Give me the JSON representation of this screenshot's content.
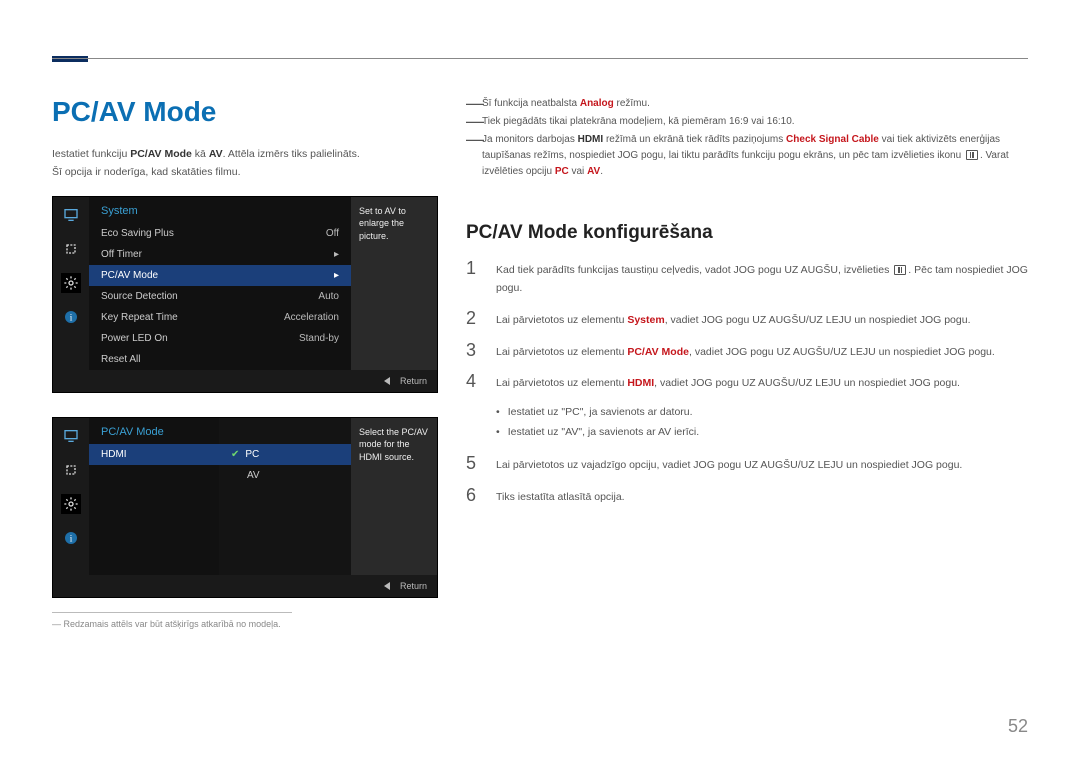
{
  "page_number": "52",
  "left": {
    "h1": "PC/AV Mode",
    "intro_pre": "Iestatiet funkciju ",
    "intro_kw1": "PC/AV Mode",
    "intro_mid": " kā ",
    "intro_kw2": "AV",
    "intro_post": ". Attēla izmērs tiks palielināts.",
    "intro2": "Šī opcija ir noderīga, kad skatāties filmu.",
    "footnote": "Redzamais attēls var būt atšķirīgs atkarībā no modeļa."
  },
  "osd1": {
    "title": "System",
    "side": "Set to AV to enlarge the picture.",
    "return": "Return",
    "rows": [
      {
        "l": "Eco Saving Plus",
        "r": "Off",
        "sel": false
      },
      {
        "l": "Off Timer",
        "r": "▸",
        "sel": false
      },
      {
        "l": "PC/AV Mode",
        "r": "▸",
        "sel": true
      },
      {
        "l": "Source Detection",
        "r": "Auto",
        "sel": false
      },
      {
        "l": "Key Repeat Time",
        "r": "Acceleration",
        "sel": false
      },
      {
        "l": "Power LED On",
        "r": "Stand-by",
        "sel": false
      },
      {
        "l": "Reset All",
        "r": "",
        "sel": false
      }
    ]
  },
  "osd2": {
    "title": "PC/AV Mode",
    "side": "Select the PC/AV mode for the HDMI source.",
    "left_item": "HDMI",
    "opts": [
      {
        "l": "PC",
        "sel": true
      },
      {
        "l": "AV",
        "sel": false
      }
    ],
    "return": "Return"
  },
  "right": {
    "dash1_pre": "Šī funkcija neatbalsta ",
    "dash1_kw": "Analog",
    "dash1_post": " režīmu.",
    "dash2": "Tiek piegādāts tikai platekrāna modeļiem, kā piemēram 16:9 vai 16:10.",
    "dash3_a": "Ja monitors darbojas ",
    "dash3_kw1": "HDMI",
    "dash3_b": " režīmā un ekrānā tiek rādīts paziņojums ",
    "dash3_kw2": "Check Signal Cable",
    "dash3_c": " vai tiek aktivizēts enerģijas taupīšanas režīms, nospiediet JOG pogu, lai tiktu parādīts funkciju pogu ekrāns, un pēc tam izvēlieties ikonu ",
    "dash3_d": ". Varat izvēlēties opciju ",
    "dash3_kw3": "PC",
    "dash3_e": " vai ",
    "dash3_kw4": "AV",
    "dash3_f": ".",
    "h2": "PC/AV Mode konfigurēšana",
    "step1_a": "Kad tiek parādīts funkcijas taustiņu ceļvedis, vadot JOG pogu UZ AUGŠU, izvēlieties ",
    "step1_b": ". Pēc tam nospiediet JOG pogu.",
    "step2_a": "Lai pārvietotos uz elementu ",
    "step2_kw": "System",
    "step2_b": ", vadiet JOG pogu UZ AUGŠU/UZ LEJU un nospiediet JOG pogu.",
    "step3_a": "Lai pārvietotos uz elementu ",
    "step3_kw": "PC/AV Mode",
    "step3_b": ", vadiet JOG pogu UZ AUGŠU/UZ LEJU un nospiediet JOG pogu.",
    "step4_a": "Lai pārvietotos uz elementu ",
    "step4_kw": "HDMI",
    "step4_b": ", vadiet JOG pogu UZ AUGŠU/UZ LEJU un nospiediet JOG pogu.",
    "bul1": "Iestatiet uz \"PC\", ja savienots ar datoru.",
    "bul2": "Iestatiet uz \"AV\", ja savienots ar AV ierīci.",
    "step5": "Lai pārvietotos uz vajadzīgo opciju, vadiet JOG pogu UZ AUGŠU/UZ LEJU un nospiediet JOG pogu.",
    "step6": "Tiks iestatīta atlasītā opcija."
  }
}
